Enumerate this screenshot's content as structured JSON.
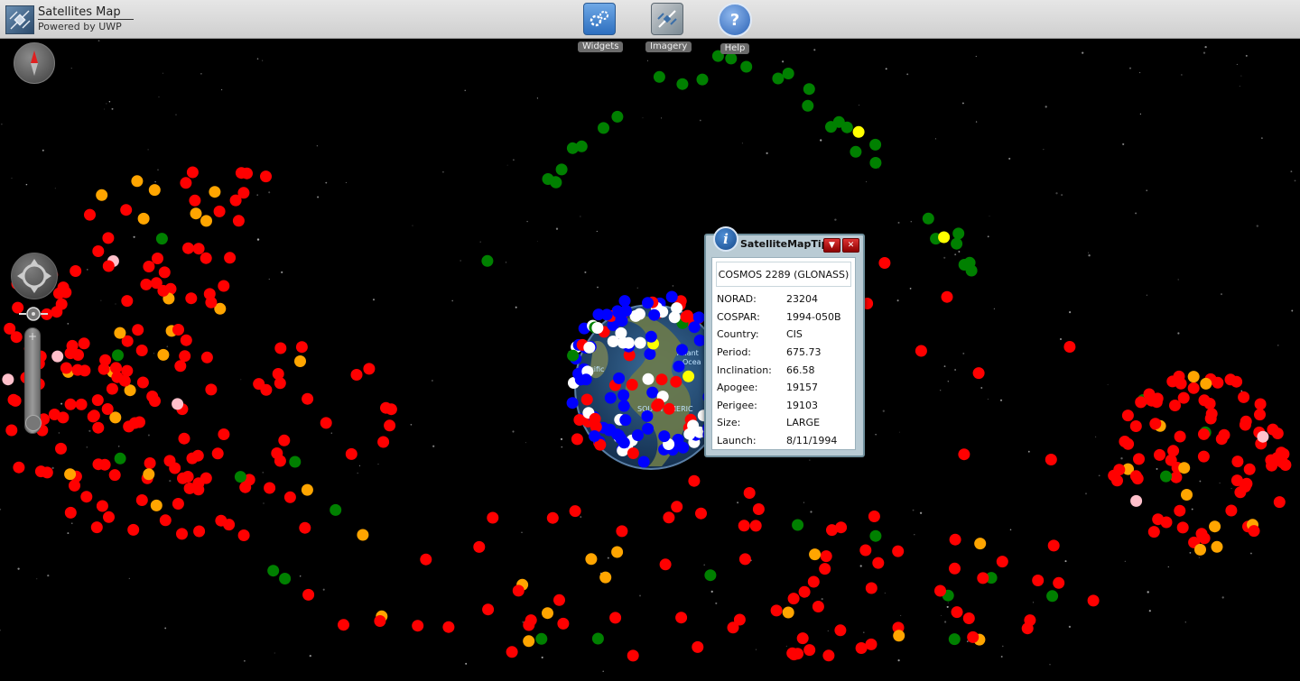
{
  "app": {
    "title": "Satellites Map",
    "subtitle": "Powered by UWP"
  },
  "toolbar": {
    "widgets": {
      "label": "Widgets",
      "icon": "widgets-icon"
    },
    "imagery": {
      "label": "Imagery",
      "icon": "imagery-icon"
    },
    "help": {
      "label": "Help",
      "icon": "help-icon"
    }
  },
  "globe": {
    "labels": [
      "SOUTH AMERIC",
      "Atlant",
      "Ocea",
      "Pacific"
    ]
  },
  "maptip": {
    "title": "SatelliteMapTip",
    "satellite_name": "COSMOS 2289 (GLONASS)",
    "fields": [
      {
        "key": "NORAD:",
        "value": "23204"
      },
      {
        "key": "COSPAR:",
        "value": "1994-050B"
      },
      {
        "key": "Country:",
        "value": "CIS"
      },
      {
        "key": "Period:",
        "value": "675.73"
      },
      {
        "key": "Inclination:",
        "value": "66.58"
      },
      {
        "key": "Apogee:",
        "value": "19157"
      },
      {
        "key": "Perigee:",
        "value": "19103"
      },
      {
        "key": "Size:",
        "value": "LARGE"
      },
      {
        "key": "Launch:",
        "value": "8/11/1994"
      }
    ]
  },
  "colors": {
    "red": "#ff0000",
    "orange": "#ffa500",
    "green": "#008000",
    "yellow": "#ffff00",
    "pink": "#ffc0cb",
    "blue": "#0000ff",
    "white": "#ffffff"
  }
}
